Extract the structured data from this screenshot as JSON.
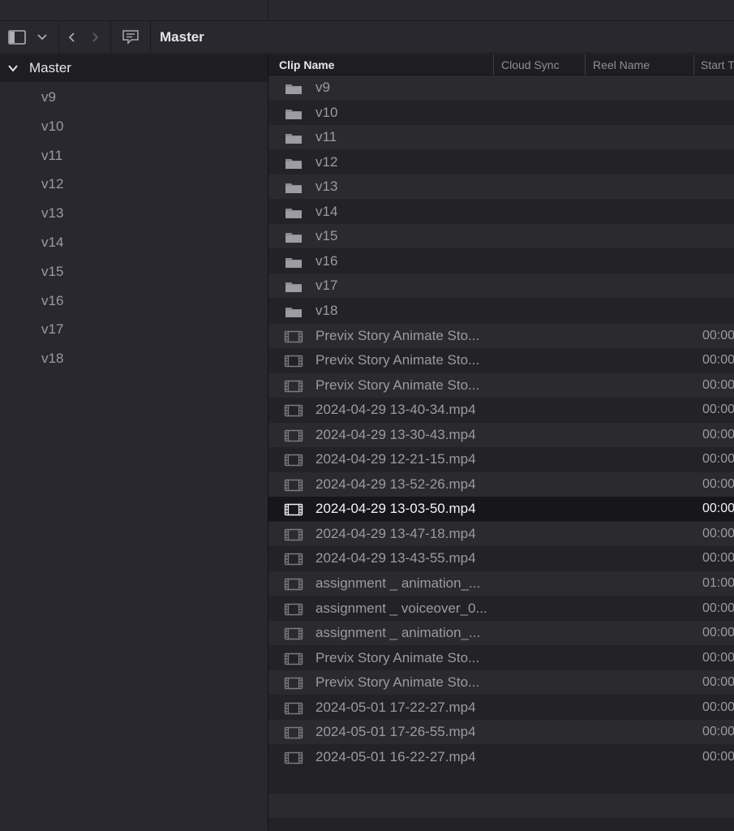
{
  "toolbar": {
    "title": "Master",
    "icons": [
      "sidebar-toggle-icon",
      "chevron-down-icon",
      "back-icon",
      "forward-icon",
      "metadata-icon"
    ]
  },
  "sidebar": {
    "root_label": "Master",
    "bins": [
      "v9",
      "v10",
      "v11",
      "v12",
      "v13",
      "v14",
      "v15",
      "v16",
      "v17",
      "v18"
    ]
  },
  "list": {
    "columns": [
      "Clip Name",
      "Cloud Sync",
      "Reel Name",
      "Start T"
    ],
    "rows": [
      {
        "type": "folder",
        "name": "v9",
        "tc": ""
      },
      {
        "type": "folder",
        "name": "v10",
        "tc": ""
      },
      {
        "type": "folder",
        "name": "v11",
        "tc": ""
      },
      {
        "type": "folder",
        "name": "v12",
        "tc": ""
      },
      {
        "type": "folder",
        "name": "v13",
        "tc": ""
      },
      {
        "type": "folder",
        "name": "v14",
        "tc": ""
      },
      {
        "type": "folder",
        "name": "v15",
        "tc": ""
      },
      {
        "type": "folder",
        "name": "v16",
        "tc": ""
      },
      {
        "type": "folder",
        "name": "v17",
        "tc": ""
      },
      {
        "type": "folder",
        "name": "v18",
        "tc": ""
      },
      {
        "type": "clip",
        "name": "Previx Story  Animate  Sto...",
        "tc": "00:00"
      },
      {
        "type": "clip",
        "name": "Previx Story  Animate  Sto...",
        "tc": "00:00"
      },
      {
        "type": "clip",
        "name": "Previx Story  Animate  Sto...",
        "tc": "00:00"
      },
      {
        "type": "clip",
        "name": "2024-04-29 13-40-34.mp4",
        "tc": "00:00"
      },
      {
        "type": "clip",
        "name": "2024-04-29 13-30-43.mp4",
        "tc": "00:00"
      },
      {
        "type": "clip",
        "name": "2024-04-29 12-21-15.mp4",
        "tc": "00:00"
      },
      {
        "type": "clip",
        "name": "2024-04-29 13-52-26.mp4",
        "tc": "00:00"
      },
      {
        "type": "clip",
        "name": "2024-04-29 13-03-50.mp4",
        "tc": "00:00",
        "selected": true
      },
      {
        "type": "clip",
        "name": "2024-04-29 13-47-18.mp4",
        "tc": "00:00"
      },
      {
        "type": "clip",
        "name": "2024-04-29 13-43-55.mp4",
        "tc": "00:00"
      },
      {
        "type": "clip",
        "name": "assignment _ animation_...",
        "tc": "01:00"
      },
      {
        "type": "clip",
        "name": "assignment _ voiceover_0...",
        "tc": "00:00"
      },
      {
        "type": "clip",
        "name": "assignment _ animation_...",
        "tc": "00:00"
      },
      {
        "type": "clip",
        "name": "Previx Story  Animate  Sto...",
        "tc": "00:00"
      },
      {
        "type": "clip",
        "name": "Previx Story  Animate  Sto...",
        "tc": "00:00"
      },
      {
        "type": "clip",
        "name": "2024-05-01 17-22-27.mp4",
        "tc": "00:00"
      },
      {
        "type": "clip",
        "name": "2024-05-01 17-26-55.mp4",
        "tc": "00:00"
      },
      {
        "type": "clip",
        "name": "2024-05-01 16-22-27.mp4",
        "tc": "00:00"
      }
    ]
  },
  "colors": {
    "background": "#28282e",
    "row_odd": "#2a2a2f",
    "row_even": "#232327",
    "row_selected": "#17171a",
    "text_primary": "#e6e6e9",
    "text_secondary": "#9a9aa0"
  }
}
